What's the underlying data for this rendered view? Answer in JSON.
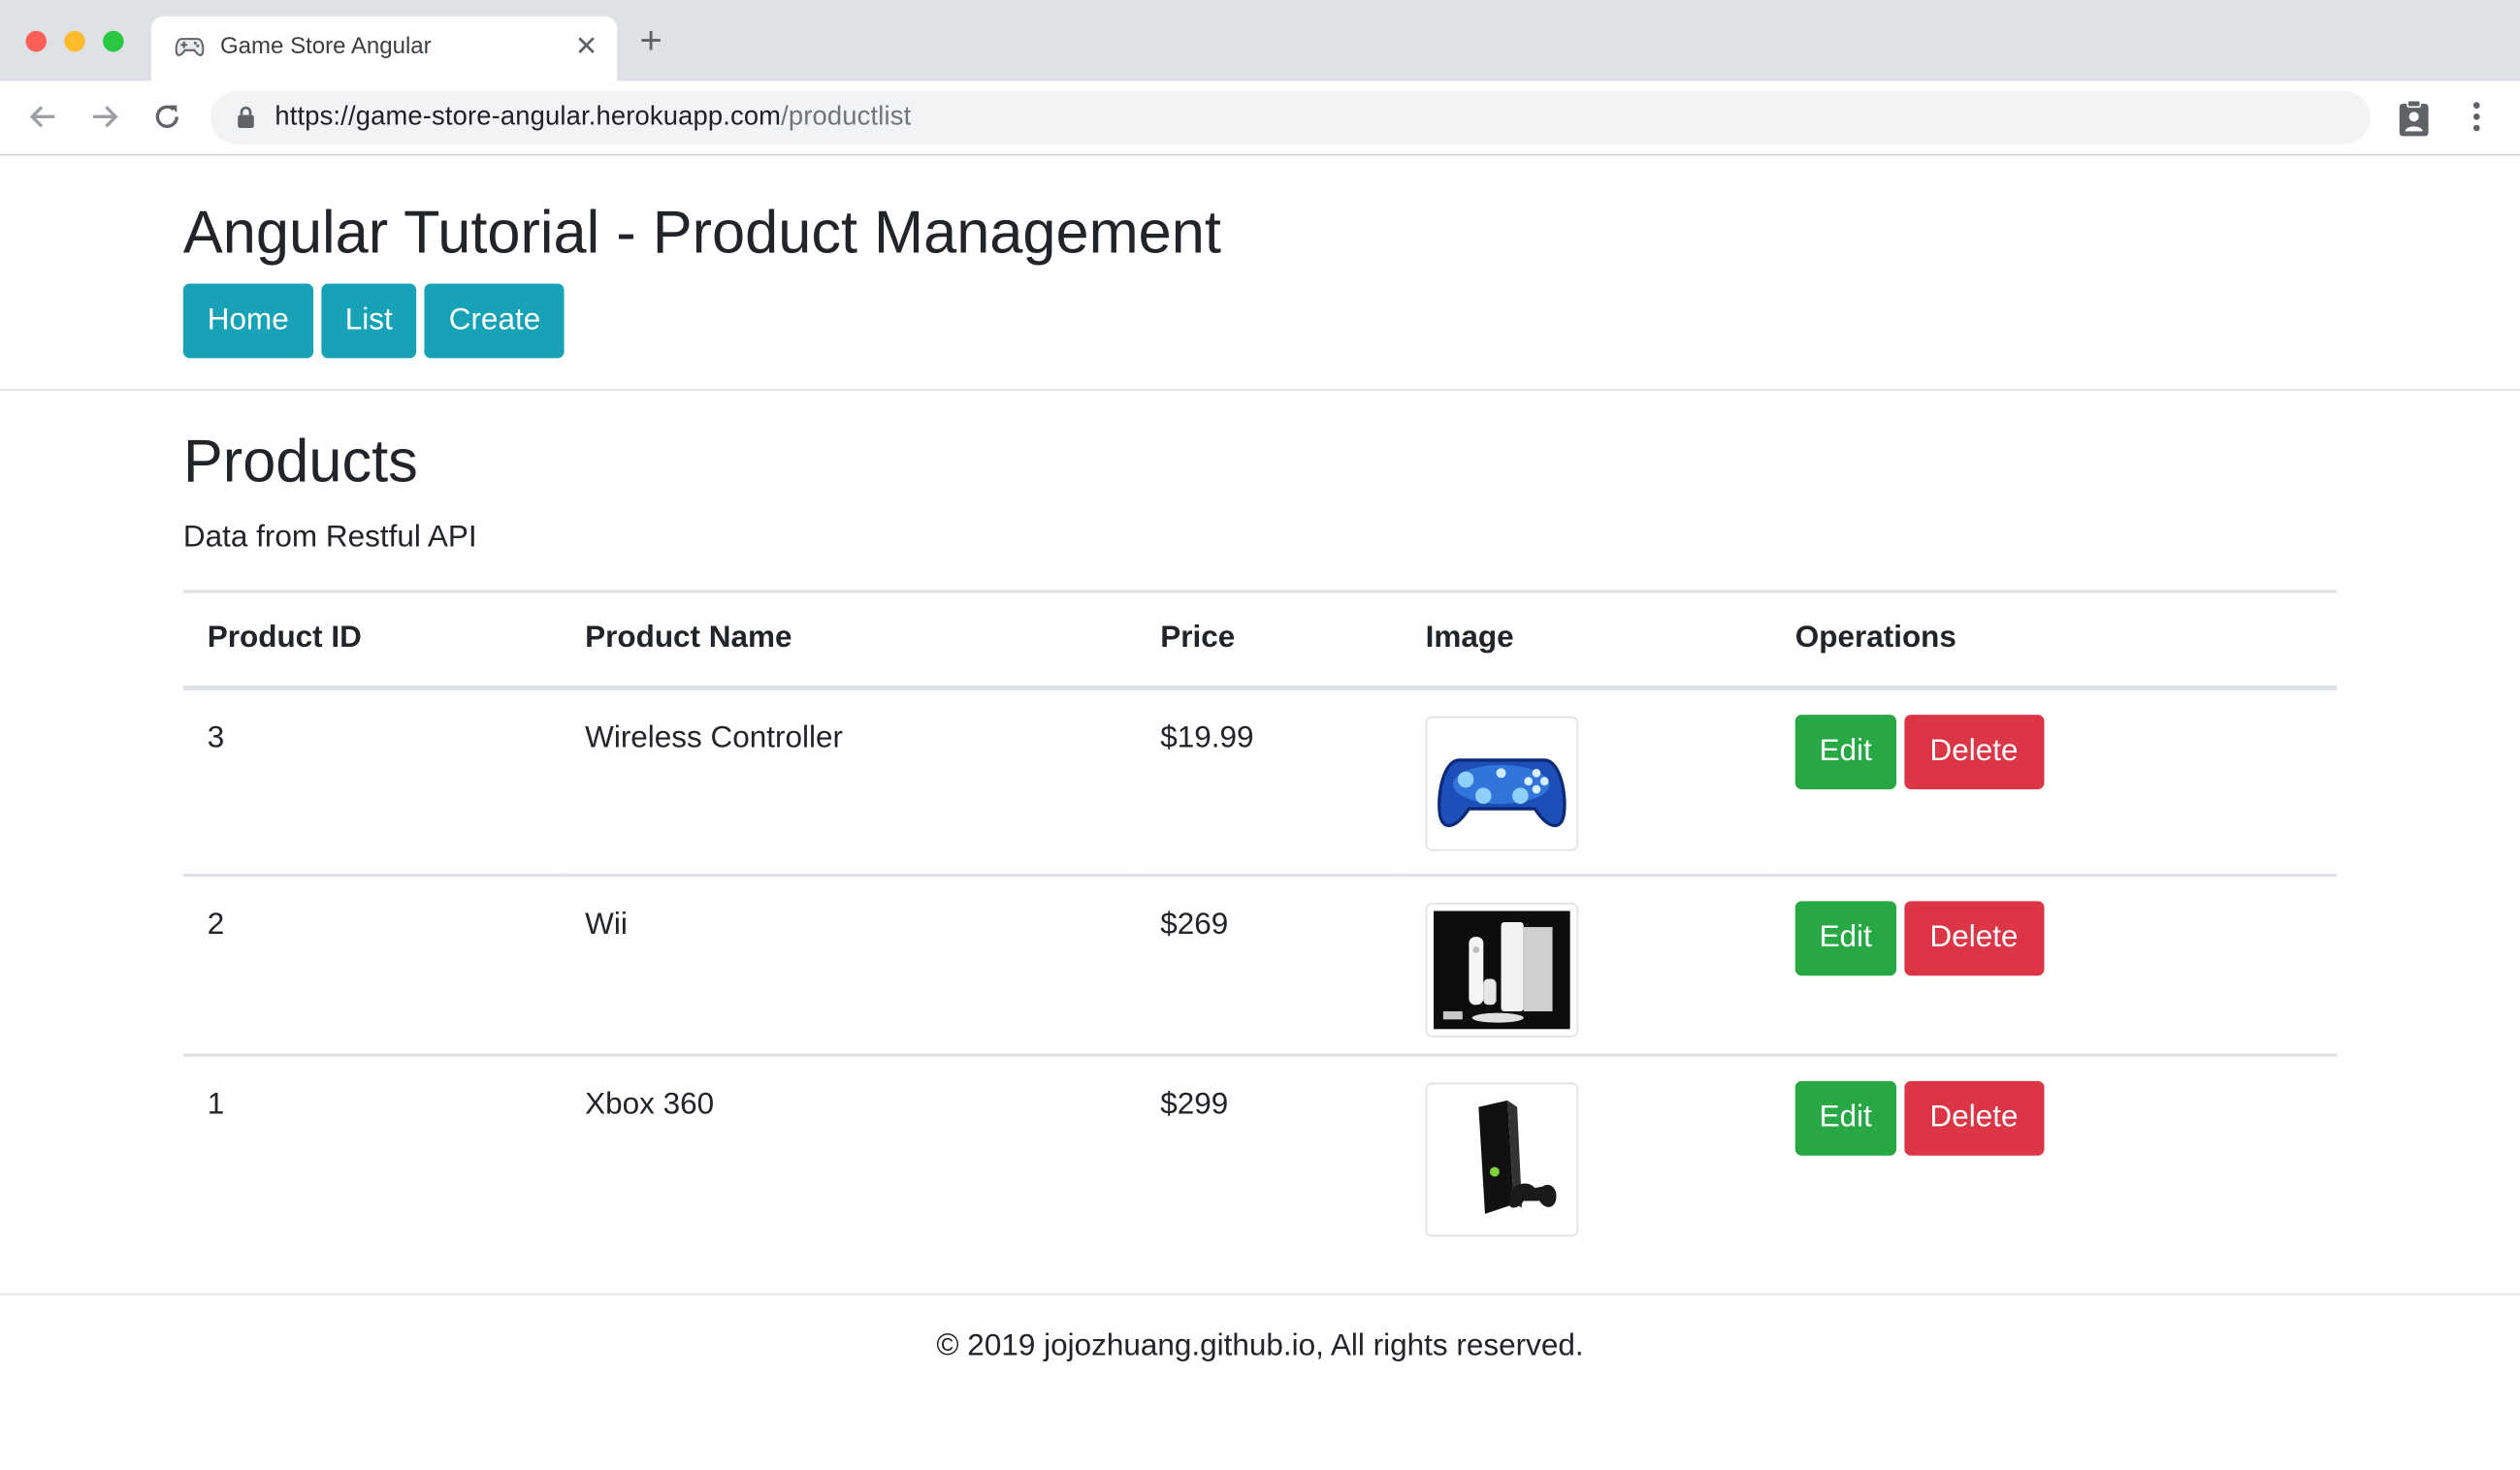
{
  "browser": {
    "tab_title": "Game Store Angular",
    "tab_close": "✕",
    "new_tab": "+",
    "url_scheme": "https://",
    "url_host": "game-store-angular.herokuapp.com",
    "url_path": "/productlist",
    "traffic_lights": [
      "#ff5f57",
      "#febc2e",
      "#28c840"
    ]
  },
  "app": {
    "title": "Angular Tutorial - Product Management",
    "nav": [
      "Home",
      "List",
      "Create"
    ],
    "accent": "#17a2b8"
  },
  "products": {
    "heading": "Products",
    "subtitle": "Data from Restful API",
    "columns": [
      "Product ID",
      "Product Name",
      "Price",
      "Image",
      "Operations"
    ],
    "rows": [
      {
        "id": "3",
        "name": "Wireless Controller",
        "price": "$19.99",
        "image": "blue-game-controller",
        "edit": "Edit",
        "delete": "Delete"
      },
      {
        "id": "2",
        "name": "Wii",
        "price": "$269",
        "image": "wii-console",
        "edit": "Edit",
        "delete": "Delete"
      },
      {
        "id": "1",
        "name": "Xbox 360",
        "price": "$299",
        "image": "xbox-360-console",
        "edit": "Edit",
        "delete": "Delete"
      }
    ],
    "edit_color": "#28a745",
    "delete_color": "#dc3545"
  },
  "footer": {
    "text": "© 2019 jojozhuang.github.io, All rights reserved."
  }
}
